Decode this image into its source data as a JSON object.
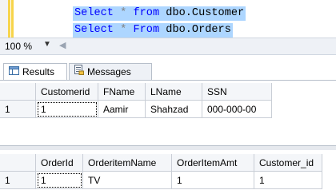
{
  "editor": {
    "lines": [
      {
        "kw1": "Select",
        "op": "*",
        "kw2": "from",
        "obj": "dbo.Customer"
      },
      {
        "kw1": "Select",
        "op": "*",
        "kw2": "From",
        "obj": "dbo.Orders"
      }
    ]
  },
  "zoom": {
    "value": "100 %"
  },
  "tabs": [
    {
      "label": "Results",
      "icon": "grid-icon"
    },
    {
      "label": "Messages",
      "icon": "messages-icon"
    }
  ],
  "result1": {
    "columns": [
      "Customerid",
      "FName",
      "LName",
      "SSN"
    ],
    "rows": [
      {
        "num": "1",
        "cells": [
          "1",
          "Aamir",
          "Shahzad",
          "000-000-00"
        ]
      }
    ]
  },
  "result2": {
    "columns": [
      "OrderId",
      "OrderitemName",
      "OrderItemAmt",
      "Customer_id"
    ],
    "rows": [
      {
        "num": "1",
        "cells": [
          "1",
          "TV",
          "1",
          "1"
        ]
      }
    ]
  }
}
